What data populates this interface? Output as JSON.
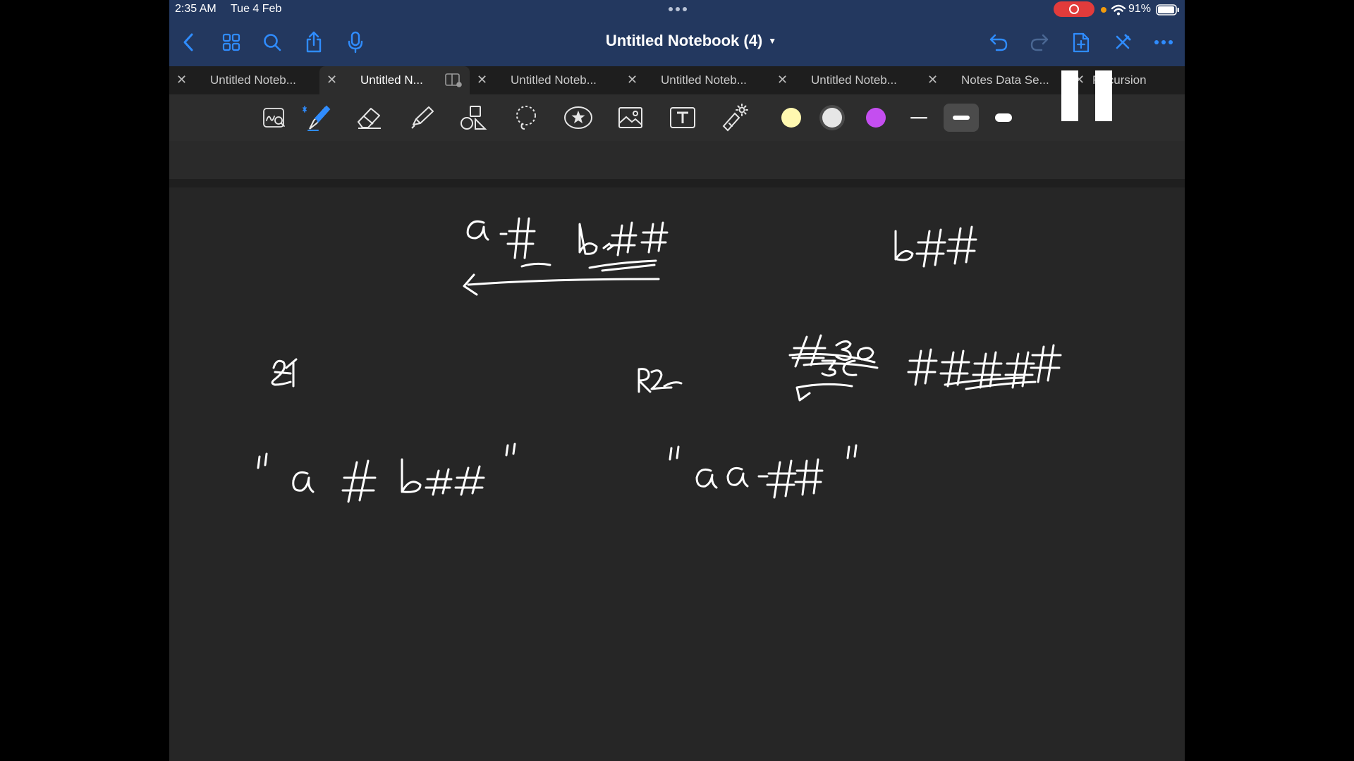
{
  "status": {
    "time": "2:35 AM",
    "date": "Tue 4 Feb",
    "battery": "91%"
  },
  "header": {
    "title": "Untitled Notebook (4)",
    "title_icon": "chevron-down-icon"
  },
  "tabs": [
    {
      "label": "Untitled Noteb...",
      "active": false
    },
    {
      "label": "Untitled N...",
      "active": true
    },
    {
      "label": "Untitled Noteb...",
      "active": false
    },
    {
      "label": "Untitled Noteb...",
      "active": false
    },
    {
      "label": "Untitled Noteb...",
      "active": false
    },
    {
      "label": "Notes Data Se...",
      "active": false
    },
    {
      "label": "Recursion",
      "active": false
    }
  ],
  "colors": {
    "topbar": "#23385f",
    "accent": "#2f8cff",
    "canvas": "#262626",
    "ink": "#ffffff",
    "recording": "#e23b3b"
  },
  "pen_colors": [
    "#fff8b0",
    "#e6e6e6",
    "#c44ef0"
  ],
  "selected_thickness": "medium"
}
